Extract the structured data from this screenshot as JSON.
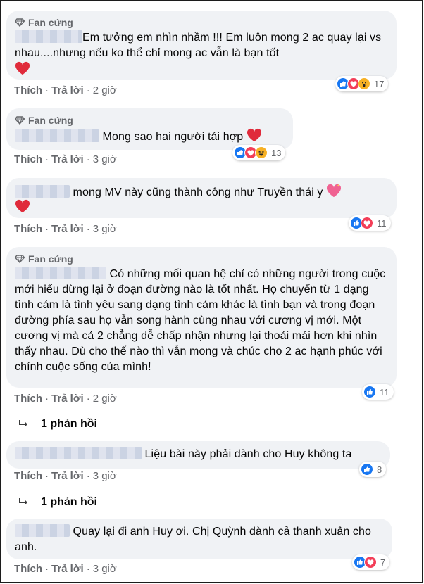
{
  "badge_label": "Fan cứng",
  "actions": {
    "like": "Thích",
    "reply": "Trả lời",
    "sep": "·"
  },
  "comments": [
    {
      "text": "Em tưởng em nhìn nhầm !!! Em luôn mong 2 ac quay lại vs nhau....nhưng nếu ko thể chỉ mong ac vẫn là bạn tốt",
      "time": "2 giờ",
      "reaction_count": "17",
      "reactions": [
        "like-icon",
        "love-icon",
        "wow-icon"
      ]
    },
    {
      "text": "Mong sao hai người tái hợp",
      "time": "3 giờ",
      "reaction_count": "13",
      "reactions": [
        "like-icon",
        "love-icon",
        "haha-icon"
      ]
    },
    {
      "text": "mong MV này cũng thành công như Truyền thái y",
      "time": "3 giờ",
      "reaction_count": "11",
      "reactions": [
        "like-icon",
        "love-icon"
      ]
    },
    {
      "text": "Có những mối quan hệ chỉ có những người trong cuộc mới hiểu dừng lại ở đoạn đường nào là tốt nhất. Họ chuyển từ 1 dạng tình cảm là tình yêu sang dạng tình cảm khác là tình bạn và trong đoạn đường phía sau họ vẫn song hành cùng nhau với cương vị mới. Một cương vị mà cả 2 chẳng dễ chấp nhận nhưng lại thoải mái hơn khi nhìn thấy nhau. Dù cho thế nào thì vẫn mong và chúc cho 2 ac hạnh phúc với chính cuộc sống của mình!",
      "time": "2 giờ",
      "reaction_count": "11",
      "reactions": [
        "like-icon"
      ]
    },
    {
      "text": "Liệu bài này phải dành cho Huy không ta",
      "time": "3 giờ",
      "reaction_count": "8",
      "reactions": [
        "like-icon"
      ]
    },
    {
      "text": "Quay lại đi anh Huy ơi. Chị Quỳnh dành cả thanh xuân cho anh.",
      "time": "3 giờ",
      "reaction_count": "7",
      "reactions": [
        "like-icon",
        "love-icon"
      ]
    }
  ],
  "replies_label": "1 phản hồi",
  "colors": {
    "bubble": "#f0f2f5",
    "like": "#1877f2",
    "love": "#f33e58",
    "wow": "#f7b125",
    "meta": "#65676b"
  }
}
